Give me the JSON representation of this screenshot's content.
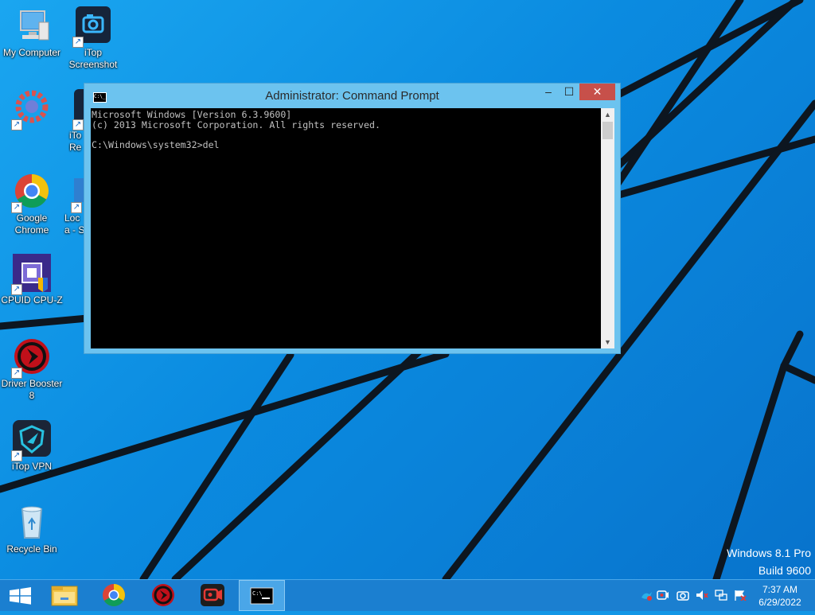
{
  "desktop": {
    "icons": [
      {
        "label": "My Computer",
        "icon": "computer-icon"
      },
      {
        "label": "iTop Screenshot",
        "icon": "camera-icon"
      },
      {
        "label": "",
        "icon": "gear-app-icon"
      },
      {
        "label": "iTo Re",
        "icon": "app-icon"
      },
      {
        "label": "Google Chrome",
        "icon": "chrome-icon"
      },
      {
        "label": "Loca - S",
        "icon": "app-icon"
      },
      {
        "label": "CPUID CPU-Z",
        "icon": "cpu-icon"
      },
      {
        "label": "Driver Booster 8",
        "icon": "driver-booster-icon"
      },
      {
        "label": "iTop VPN",
        "icon": "vpn-icon"
      },
      {
        "label": "Recycle Bin",
        "icon": "recycle-bin-icon"
      }
    ]
  },
  "cmd": {
    "title": "Administrator: Command Prompt",
    "icon_text": "C:\\_",
    "lines": [
      "Microsoft Windows [Version 6.3.9600]",
      "(c) 2013 Microsoft Corporation. All rights reserved.",
      "",
      "C:\\Windows\\system32>del"
    ],
    "min_glyph": "–",
    "max_glyph": "☐",
    "close_glyph": "✕"
  },
  "watermark": {
    "line1": "Windows 8.1 Pro",
    "line2": "Build 9600"
  },
  "taskbar": {
    "start_icon": "windows-logo-icon",
    "pinned": [
      "file-explorer-icon",
      "chrome-icon",
      "driver-booster-icon",
      "screen-recorder-icon",
      "cmd-icon"
    ],
    "tray_icons": [
      "bird-icon",
      "recorder-tray-icon",
      "camera-tray-icon",
      "speaker-muted-icon",
      "network-icon",
      "flag-icon"
    ],
    "time": "7:37 AM",
    "date": "6/29/2022"
  },
  "colors": {
    "accent": "#1b7fd0",
    "close_button": "#c7504a",
    "console_bg": "#000000"
  }
}
